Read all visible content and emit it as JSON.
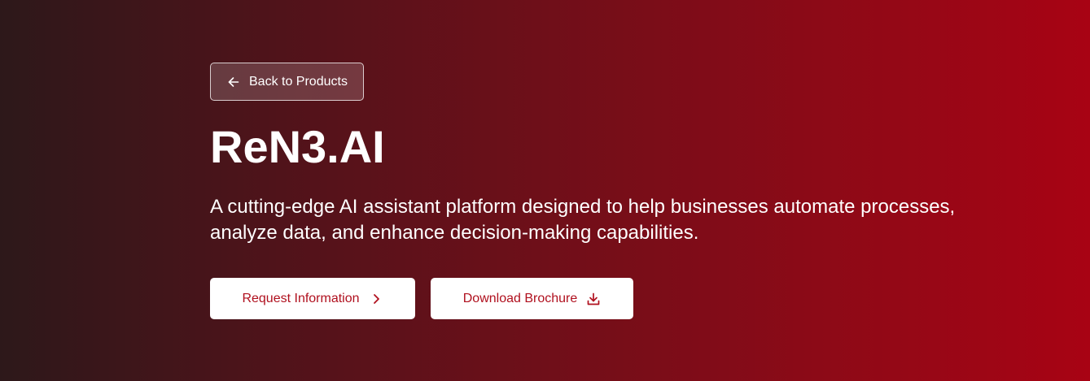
{
  "hero": {
    "back_label": "Back to Products",
    "title": "ReN3.AI",
    "description": "A cutting-edge AI assistant platform designed to help businesses automate processes, analyze data, and enhance decision-making capabilities.",
    "actions": {
      "request_label": "Request Information",
      "download_label": "Download Brochure"
    },
    "icons": {
      "back": "arrow-left-icon",
      "request": "chevron-right-icon",
      "download": "download-icon"
    }
  },
  "colors": {
    "gradient_start": "#2d181a",
    "gradient_end": "#a80314",
    "accent_text": "#b0101e",
    "button_bg": "#ffffff"
  }
}
